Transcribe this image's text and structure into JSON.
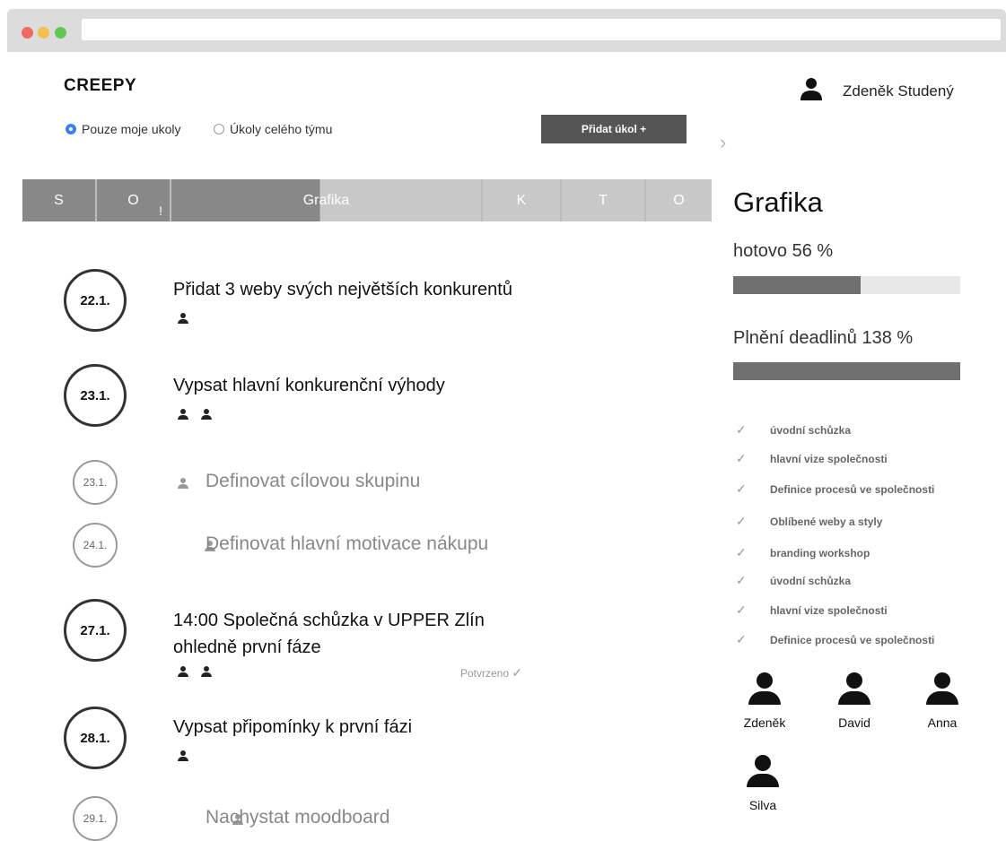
{
  "app": {
    "logo": "CREEPY"
  },
  "filters": [
    {
      "label": "Pouze moje ukoly",
      "selected": true
    },
    {
      "label": "Úkoly celého týmu",
      "selected": false
    }
  ],
  "add_button": "Přidat úkol  +",
  "user": {
    "name": "Zdeněk Studený",
    "icon": "user-icon"
  },
  "tabs": [
    {
      "label": "S",
      "active": true
    },
    {
      "label": "O",
      "active": true,
      "alert": "!"
    },
    {
      "label": "Grafika",
      "active": true
    },
    {
      "label": "K",
      "active": false
    },
    {
      "label": "T",
      "active": false
    },
    {
      "label": "O",
      "active": false
    }
  ],
  "tasks": [
    {
      "date": "22.1.",
      "title": "Přidat 3 weby svých největších konkurentů",
      "people": 1,
      "done": false
    },
    {
      "date": "23.1.",
      "title": "Vypsat hlavní konkurenční výhody",
      "people": 2,
      "done": false
    },
    {
      "date": "23.1.",
      "title": "Definovat cílovou skupinu",
      "people": 1,
      "done": true
    },
    {
      "date": "24.1.",
      "title": "Definovat hlavní motivace nákupu",
      "people": 1,
      "done": true
    },
    {
      "date": "27.1.",
      "title_line1": "14:00 Společná schůzka v UPPER Zlín",
      "title_line2": "ohledně první fáze",
      "people": 2,
      "done": false,
      "status": "Potvrzeno"
    },
    {
      "date": "28.1.",
      "title": "Vypsat připomínky k první fázi",
      "people": 1,
      "done": false
    },
    {
      "date": "29.1.",
      "title": "Nachystat moodboard",
      "people": 1,
      "done": true
    }
  ],
  "panel": {
    "title": "Grafika",
    "progress_label": "hotovo 56 %",
    "progress_value": 0.56,
    "deadline_label": "Plnění deadlinů 138 %",
    "deadline_value": 1.0,
    "checklist": [
      "úvodní schůzka",
      "hlavní vize společnosti",
      "Definice procesů ve společnosti",
      "Oblíbené weby a styly",
      "branding workshop",
      "úvodní schůzka",
      "hlavní vize společnosti",
      "Definice procesů ve společnosti"
    ],
    "team": [
      "Zdeněk",
      "David",
      "Anna",
      "Silva"
    ]
  },
  "colors": {
    "accent": "#3b82f6",
    "button": "#555555",
    "tab_active": "#888888",
    "tab_inactive": "#c8c8c8"
  }
}
